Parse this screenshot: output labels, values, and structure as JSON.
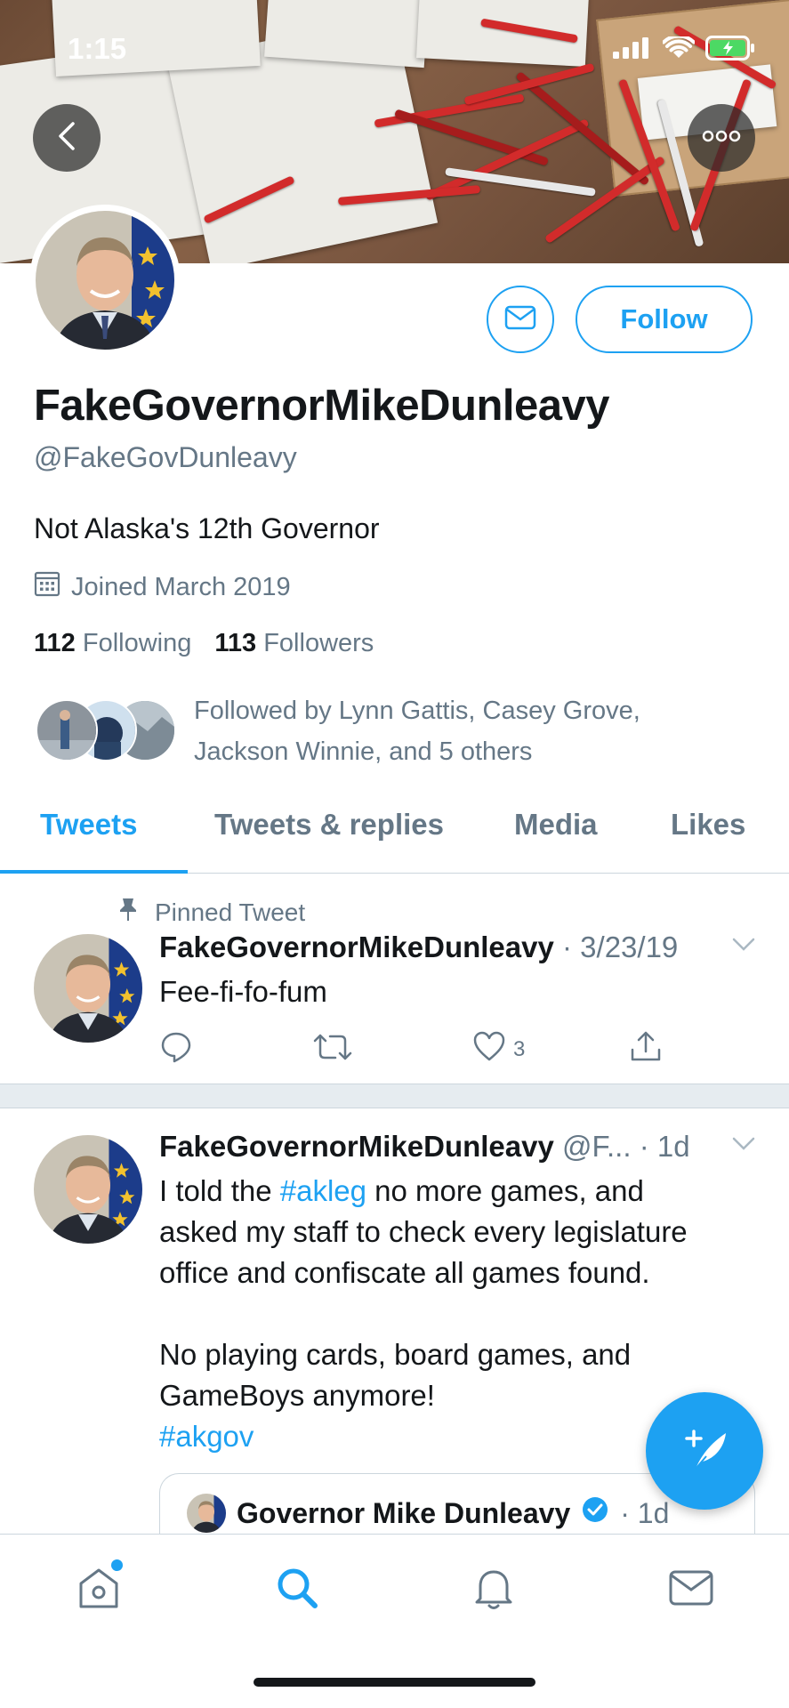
{
  "status_bar": {
    "time": "1:15"
  },
  "profile": {
    "display_name": "FakeGovernorMikeDunleavy",
    "handle": "@FakeGovDunleavy",
    "bio": "Not Alaska's 12th Governor",
    "joined": "Joined March 2019",
    "following_count": "112",
    "following_label": "Following",
    "followers_count": "113",
    "followers_label": "Followers",
    "followed_by_line1": "Followed by Lynn Gattis, Casey Grove,",
    "followed_by_line2": "Jackson Winnie, and 5 others",
    "follow_button": "Follow"
  },
  "tabs": [
    {
      "label": "Tweets",
      "active": true
    },
    {
      "label": "Tweets & replies",
      "active": false
    },
    {
      "label": "Media",
      "active": false
    },
    {
      "label": "Likes",
      "active": false
    }
  ],
  "tweets": [
    {
      "pinned_label": "Pinned Tweet",
      "author": "FakeGovernorMikeDunleavy",
      "meta": "· 3/23/19",
      "text": "Fee-fi-fo-fum",
      "likes": "3"
    },
    {
      "author": "FakeGovernorMikeDunleavy",
      "meta": "@F... · 1d",
      "text_line1_pre": "I told the ",
      "hashtag1": "#akleg",
      "text_line1_post": " no more games, and",
      "text_line2": "asked my staff to check every legislature",
      "text_line3": "office and confiscate all games found.",
      "text_line4": "No playing cards, board games, and",
      "text_line5": "GameBoys anymore!",
      "hashtag2": "#akgov",
      "quote": {
        "author": "Governor Mike Dunleavy",
        "meta": "· 1d"
      }
    }
  ],
  "colors": {
    "accent": "#1da1f2",
    "text": "#14171a",
    "secondary": "#657786",
    "separator": "#e6ecf0"
  }
}
